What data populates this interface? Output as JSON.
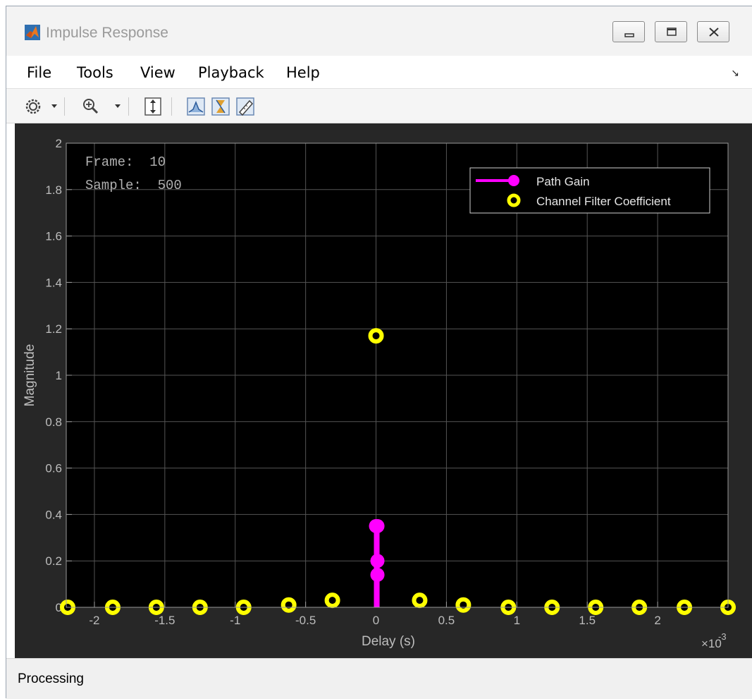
{
  "window": {
    "title": "Impulse Response"
  },
  "menu": {
    "items": [
      "File",
      "Tools",
      "View",
      "Playback",
      "Help"
    ]
  },
  "toolbar": {
    "icons": [
      "settings-icon",
      "zoom-in-icon",
      "scale-axes-icon",
      "peak-finder-icon",
      "data-cursor-icon",
      "measure-icon"
    ]
  },
  "plot": {
    "overlay_frame": "Frame:  10",
    "overlay_sample": "Sample:  500",
    "exponent_label": "×10",
    "exponent_power": "-3",
    "colors": {
      "background": "#000000",
      "axes_text": "#bdbdbd",
      "grid": "#5a5a5a",
      "path_gain": "#ff00ff",
      "channel_filter": "#ffff00"
    }
  },
  "chart_data": {
    "type": "scatter",
    "title": "",
    "xlabel": "Delay (s)",
    "ylabel": "Magnitude",
    "x_scale_factor": 0.001,
    "xlim": [
      -2.2,
      2.5
    ],
    "ylim": [
      0,
      2
    ],
    "xticks": [
      -2,
      -1.5,
      -1,
      -0.5,
      0,
      0.5,
      1,
      1.5,
      2
    ],
    "xtick_labels": [
      "-2",
      "-1.5",
      "-1",
      "-0.5",
      "0",
      "0.5",
      "1",
      "1.5",
      "2"
    ],
    "yticks": [
      0,
      0.2,
      0.4,
      0.6,
      0.8,
      1,
      1.2,
      1.4,
      1.6,
      1.8,
      2
    ],
    "ytick_labels": [
      "0",
      "0.2",
      "0.4",
      "0.6",
      "0.8",
      "1",
      "1.2",
      "1.4",
      "1.6",
      "1.8",
      "2"
    ],
    "grid": true,
    "legend_position": "top-right",
    "series": [
      {
        "name": "Path Gain",
        "style": "stem",
        "color": "#ff00ff",
        "x": [
          0,
          0.01,
          0.01,
          0.01
        ],
        "y": [
          0.35,
          0.35,
          0.2,
          0.14
        ]
      },
      {
        "name": "Channel Filter Coefficient",
        "style": "markers",
        "color": "#ffff00",
        "x": [
          -2.19,
          -1.87,
          -1.56,
          -1.25,
          -0.94,
          -0.62,
          -0.31,
          0,
          0.31,
          0.62,
          0.94,
          1.25,
          1.56,
          1.87,
          2.19,
          2.5
        ],
        "y": [
          0.0,
          0.0,
          0.0,
          0.0,
          0.0,
          0.01,
          0.03,
          1.17,
          0.03,
          0.01,
          0.0,
          0.0,
          0.0,
          0.0,
          0.0,
          0.0
        ]
      }
    ]
  },
  "status": {
    "text": "Processing"
  }
}
